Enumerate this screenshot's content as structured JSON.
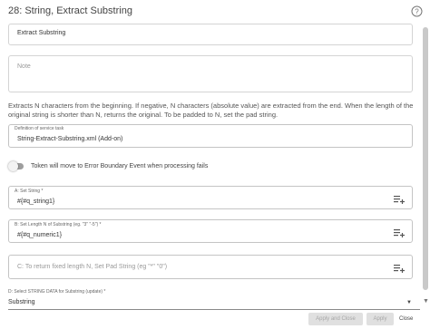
{
  "dialog": {
    "title": "28: String, Extract Substring",
    "help_icon": "help-circle-icon"
  },
  "form": {
    "name_value": "Extract Substring",
    "note_placeholder": "Note",
    "description": "Extracts N characters from the beginning. If negative, N characters (absolute value) are extracted from the end. When the length of the original string is shorter than N, returns the original. To be padded to N, set the pad string.",
    "service_task": {
      "label": "Definition of service task",
      "value": "String-Extract-Substring.xml (Add-on)"
    },
    "error_toggle": {
      "label": "Token will move to Error Boundary Event when processing fails",
      "checked": false
    },
    "field_a": {
      "label": "A: Set String *",
      "value": "#{#q_string1}",
      "icon": "insert-reference-icon"
    },
    "field_b": {
      "label": "B: Set Length N of Substring (eg. \"3\" \"-5\") *",
      "value": "#{#q_numeric1}",
      "icon": "insert-reference-icon"
    },
    "field_c": {
      "placeholder": "C: To return fixed length N, Set Pad String (eg \"*\" \"0\")",
      "value": "",
      "icon": "insert-reference-icon"
    },
    "field_d": {
      "label": "D: Select STRING DATA for Substring (update) *",
      "value": "Substring",
      "icon": "dropdown-arrow-icon"
    }
  },
  "footer": {
    "apply_close_label": "Apply and Close",
    "apply_label": "Apply",
    "close_label": "Close"
  },
  "colors": {
    "border": "#d4d4d4",
    "disabled_button_bg": "#e0e0e0",
    "disabled_button_text": "#a6a6a6",
    "toggle_track": "#9e9e9e"
  }
}
